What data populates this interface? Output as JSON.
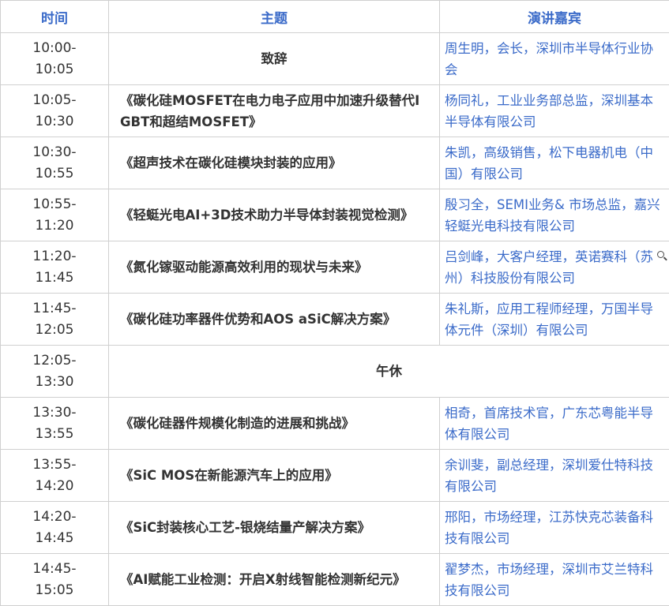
{
  "headers": {
    "time": "时间",
    "topic": "主题",
    "speaker": "演讲嘉宾"
  },
  "rows": [
    {
      "time": "10:00-\n10:05",
      "topic": "致辞",
      "speaker": "周生明，会长，深圳市半导体行业协会"
    },
    {
      "time": "10:05-\n10:30",
      "topic": "《碳化硅MOSFET在电力电子应用中加速升级替代IGBT和超结MOSFET》",
      "speaker": "杨同礼，工业业务部总监，深圳基本半导体有限公司"
    },
    {
      "time": "10:30-\n10:55",
      "topic": "《超声技术在碳化硅模块封装的应用》",
      "speaker": "朱凯，高级销售，松下电器机电（中国）有限公司"
    },
    {
      "time": "10:55-\n11:20",
      "topic": "《轻蜓光电AI+3D技术助力半导体封装视觉检测》",
      "speaker": "殷习全，SEMI业务& 市场总监，嘉兴轻蜓光电科技有限公司"
    },
    {
      "time": "11:20-\n11:45",
      "topic": "《氮化镓驱动能源高效利用的现状与未来》",
      "speaker": "吕剑峰，大客户经理，英诺赛科（苏州）科技股份有限公司"
    },
    {
      "time": "11:45-\n12:05",
      "topic": "《碳化硅功率器件优势和AOS aSiC解决方案》",
      "speaker": "朱礼斯，应用工程师经理，万国半导体元件（深圳）有限公司"
    },
    {
      "time": "12:05-\n13:30",
      "topic": "午休",
      "speaker": ""
    },
    {
      "time": "13:30-\n13:55",
      "topic": "《碳化硅器件规模化制造的进展和挑战》",
      "speaker": "相奇，首席技术官，广东芯粤能半导体有限公司"
    },
    {
      "time": "13:55-\n14:20",
      "topic": "《SiC MOS在新能源汽车上的应用》",
      "speaker": "余训斐，副总经理，深圳爱仕特科技有限公司"
    },
    {
      "time": "14:20-\n14:45",
      "topic": "《SiC封装核心工艺-银烧结量产解决方案》",
      "speaker": "邢阳，市场经理，江苏快克芯装备科技有限公司"
    },
    {
      "time": "14:45-\n15:05",
      "topic": "《AI赋能工业检测：开启X射线智能检测新纪元》",
      "speaker": "翟梦杰，市场经理，深圳市艾兰特科技有限公司"
    }
  ]
}
